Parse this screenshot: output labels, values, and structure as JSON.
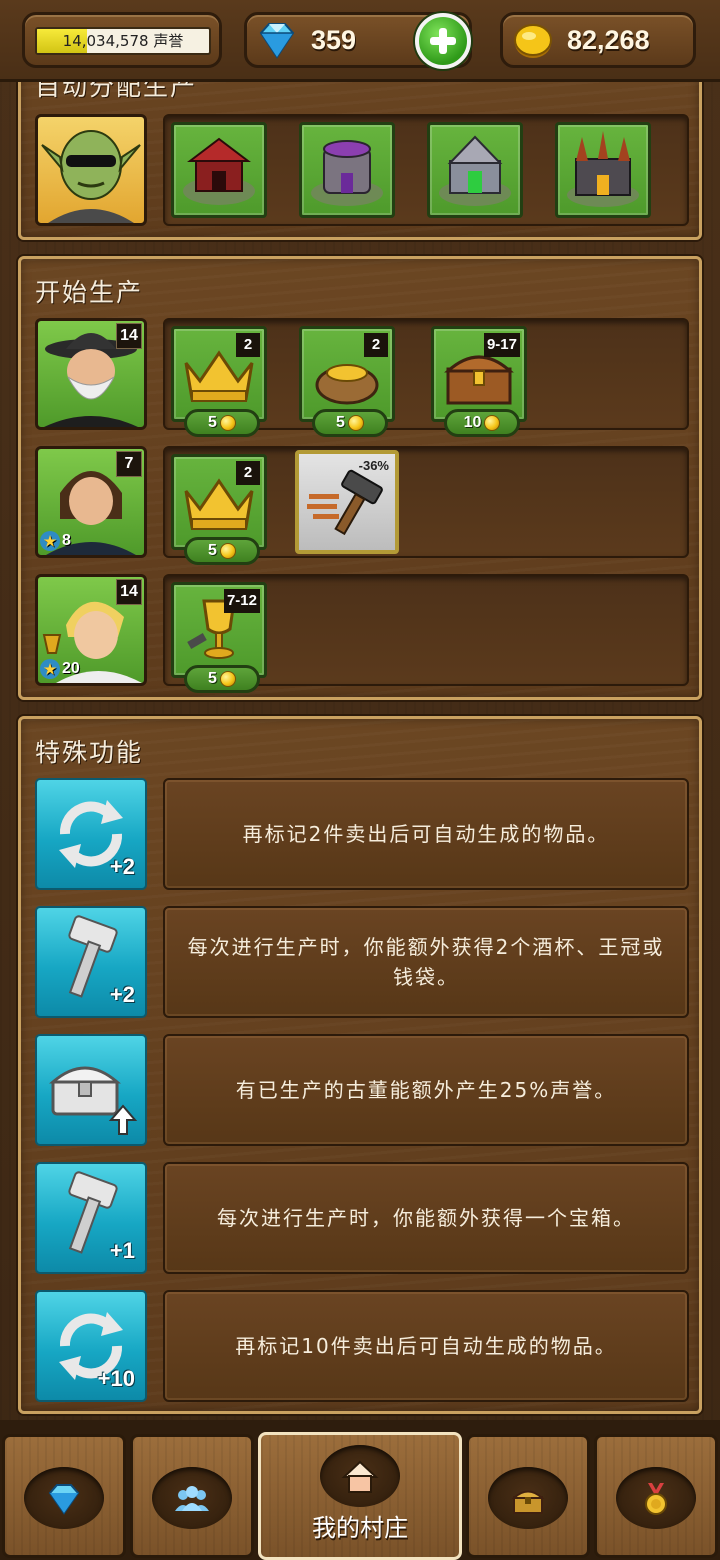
{
  "topbar": {
    "reputation": {
      "value": "14,034,578",
      "unit": "声誉",
      "progress": 0.29
    },
    "gems": {
      "value": "359",
      "icon": "diamond-icon"
    },
    "add_button_icon": "plus-icon",
    "gold": {
      "value": "82,268",
      "icon": "gold-coin-icon"
    }
  },
  "auto_panel": {
    "title": "自动分配生产",
    "manager_icon": "orc-manager-portrait",
    "buildings": [
      "red-tent-building-icon",
      "purple-tower-building-icon",
      "green-temple-building-icon",
      "dark-castle-building-icon"
    ]
  },
  "production": {
    "title": "开始生产",
    "rows": [
      {
        "worker": {
          "icon": "old-wizard-portrait",
          "level": "14",
          "stars": ""
        },
        "items": [
          {
            "icon": "crown-icon",
            "count": "2",
            "cost": "5"
          },
          {
            "icon": "coin-bag-icon",
            "count": "2",
            "cost": "5"
          },
          {
            "icon": "treasure-chest-icon",
            "count": "9-17",
            "cost": "10"
          }
        ]
      },
      {
        "worker": {
          "icon": "young-man-portrait",
          "level": "7",
          "stars": "8"
        },
        "items": [
          {
            "icon": "crown-icon",
            "count": "2",
            "cost": "5"
          }
        ],
        "boost": {
          "icon": "hammer-speed-icon",
          "label": "-36%"
        }
      },
      {
        "worker": {
          "icon": "blond-youth-portrait",
          "level": "14",
          "stars": "20"
        },
        "items": [
          {
            "icon": "goblet-icon",
            "count": "7-12",
            "cost": "5"
          }
        ]
      }
    ]
  },
  "special": {
    "title": "特殊功能",
    "features": [
      {
        "icon": "refresh-icon",
        "badge": "+2",
        "text": "再标记2件卖出后可自动生成的物品。"
      },
      {
        "icon": "hammer-icon",
        "badge": "+2",
        "text": "每次进行生产时，你能额外获得2个酒杯、王冠或钱袋。"
      },
      {
        "icon": "chest-up-icon",
        "badge": "",
        "text": "有已生产的古董能额外产生25%声誉。"
      },
      {
        "icon": "hammer-icon",
        "badge": "+1",
        "text": "每次进行生产时，你能额外获得一个宝箱。"
      },
      {
        "icon": "refresh-icon",
        "badge": "+10",
        "text": "再标记10件卖出后可自动生成的物品。"
      }
    ]
  },
  "nav": {
    "items": [
      {
        "icon": "diamond-icon",
        "label": ""
      },
      {
        "icon": "people-icon",
        "label": ""
      },
      {
        "icon": "house-icon",
        "label": "我的村庄",
        "active": true
      },
      {
        "icon": "treasure-chest-icon",
        "label": ""
      },
      {
        "icon": "medal-icon",
        "label": ""
      }
    ]
  }
}
